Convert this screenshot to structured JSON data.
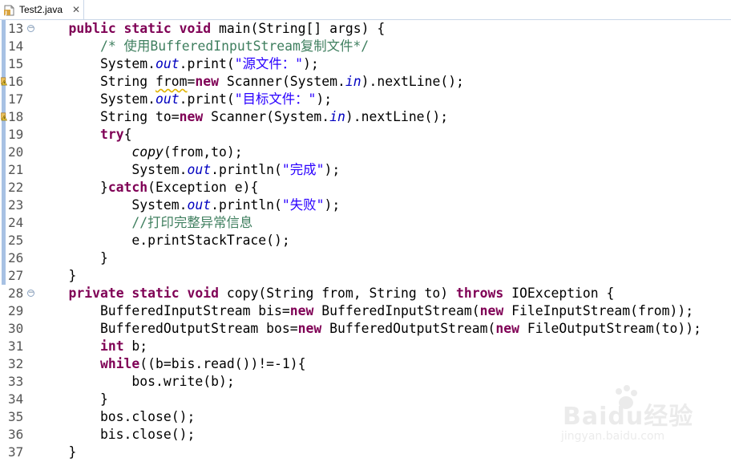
{
  "tab": {
    "title": "Test2.java",
    "close_glyph": "✕",
    "icon": "java-file-icon"
  },
  "lines": [
    {
      "n": "13",
      "fold": true
    },
    {
      "n": "14"
    },
    {
      "n": "15"
    },
    {
      "n": "16",
      "warn": true
    },
    {
      "n": "17"
    },
    {
      "n": "18",
      "warn": true
    },
    {
      "n": "19"
    },
    {
      "n": "20"
    },
    {
      "n": "21"
    },
    {
      "n": "22"
    },
    {
      "n": "23"
    },
    {
      "n": "24"
    },
    {
      "n": "25"
    },
    {
      "n": "26"
    },
    {
      "n": "27"
    },
    {
      "n": "28",
      "fold": true
    },
    {
      "n": "29"
    },
    {
      "n": "30"
    },
    {
      "n": "31"
    },
    {
      "n": "32"
    },
    {
      "n": "33"
    },
    {
      "n": "34"
    },
    {
      "n": "35"
    },
    {
      "n": "36"
    },
    {
      "n": "37"
    }
  ],
  "code": [
    [
      [
        "    ",
        ""
      ],
      [
        "public static void",
        "kw"
      ],
      [
        " main(String[] args) {",
        ""
      ]
    ],
    [
      [
        "        ",
        ""
      ],
      [
        "/* 使用BufferedInputStream复制文件*/",
        "cm"
      ]
    ],
    [
      [
        "        System.",
        ""
      ],
      [
        "out",
        "fi"
      ],
      [
        ".print(",
        ""
      ],
      [
        "\"源文件：\"",
        "st"
      ],
      [
        ");",
        ""
      ]
    ],
    [
      [
        "        String ",
        ""
      ],
      [
        "from",
        "squig"
      ],
      [
        "=",
        ""
      ],
      [
        "new",
        "kw"
      ],
      [
        " Scanner(System.",
        ""
      ],
      [
        "in",
        "fi"
      ],
      [
        ").nextLine();",
        ""
      ]
    ],
    [
      [
        "        System.",
        ""
      ],
      [
        "out",
        "fi"
      ],
      [
        ".print(",
        ""
      ],
      [
        "\"目标文件：\"",
        "st"
      ],
      [
        ");",
        ""
      ]
    ],
    [
      [
        "        String to=",
        ""
      ],
      [
        "new",
        "kw"
      ],
      [
        " Scanner(System.",
        ""
      ],
      [
        "in",
        "fi"
      ],
      [
        ").nextLine();",
        ""
      ]
    ],
    [
      [
        "        ",
        ""
      ],
      [
        "try",
        "kw"
      ],
      [
        "{",
        ""
      ]
    ],
    [
      [
        "            ",
        ""
      ],
      [
        "copy",
        "sm"
      ],
      [
        "(from,to);",
        ""
      ]
    ],
    [
      [
        "            System.",
        ""
      ],
      [
        "out",
        "fi"
      ],
      [
        ".println(",
        ""
      ],
      [
        "\"完成\"",
        "st"
      ],
      [
        ");",
        ""
      ]
    ],
    [
      [
        "        }",
        ""
      ],
      [
        "catch",
        "kw"
      ],
      [
        "(Exception e){",
        ""
      ]
    ],
    [
      [
        "            System.",
        ""
      ],
      [
        "out",
        "fi"
      ],
      [
        ".println(",
        ""
      ],
      [
        "\"失败\"",
        "st"
      ],
      [
        ");",
        ""
      ]
    ],
    [
      [
        "            ",
        ""
      ],
      [
        "//打印完整异常信息",
        "cm"
      ]
    ],
    [
      [
        "            e.printStackTrace();",
        ""
      ]
    ],
    [
      [
        "        }",
        ""
      ]
    ],
    [
      [
        "    }",
        ""
      ]
    ],
    [
      [
        "    ",
        ""
      ],
      [
        "private static void",
        "kw"
      ],
      [
        " copy(String from, String to) ",
        ""
      ],
      [
        "throws",
        "kw"
      ],
      [
        " IOException {",
        ""
      ]
    ],
    [
      [
        "        BufferedInputStream bis=",
        ""
      ],
      [
        "new",
        "kw"
      ],
      [
        " BufferedInputStream(",
        ""
      ],
      [
        "new",
        "kw"
      ],
      [
        " FileInputStream(from));",
        ""
      ]
    ],
    [
      [
        "        BufferedOutputStream bos=",
        ""
      ],
      [
        "new",
        "kw"
      ],
      [
        " BufferedOutputStream(",
        ""
      ],
      [
        "new",
        "kw"
      ],
      [
        " FileOutputStream(to));",
        ""
      ]
    ],
    [
      [
        "        ",
        ""
      ],
      [
        "int",
        "kw"
      ],
      [
        " b;",
        ""
      ]
    ],
    [
      [
        "        ",
        ""
      ],
      [
        "while",
        "kw"
      ],
      [
        "((b=bis.read())!=-1){",
        ""
      ]
    ],
    [
      [
        "            bos.write(b);",
        ""
      ]
    ],
    [
      [
        "        }",
        ""
      ]
    ],
    [
      [
        "        bos.close();",
        ""
      ]
    ],
    [
      [
        "        bis.close();",
        ""
      ]
    ],
    [
      [
        "    }",
        ""
      ]
    ]
  ],
  "watermark": {
    "brand": "Baidu经验",
    "url": "jingyan.baidu.com"
  },
  "colors": {
    "keyword": "#7f0055",
    "comment": "#3f7f5f",
    "string": "#2a00ff",
    "field": "#0000c0",
    "line_number": "#555555",
    "change_strip": "#a7c1e3"
  }
}
